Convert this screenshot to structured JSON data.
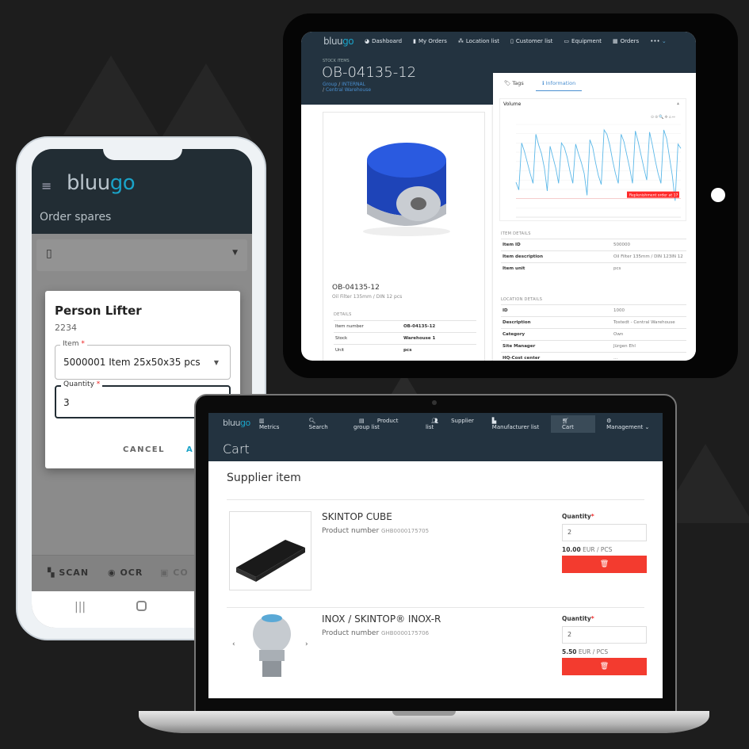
{
  "tablet": {
    "logo": {
      "a": "bluu",
      "b": "go"
    },
    "nav": [
      "Dashboard",
      "My Orders",
      "Location list",
      "Customer list",
      "Equipment",
      "Orders",
      "•••"
    ],
    "nav_icons": [
      "dashboard-icon",
      "clipboard-icon",
      "sitemap-icon",
      "building-icon",
      "keyboard-icon",
      "table-icon",
      "more-icon"
    ],
    "section_label": "STOCK ITEMS",
    "title": "OB-04135-12",
    "breadcrumb": [
      "Group",
      "INTERNAL",
      "Central Warehouse"
    ],
    "tabs": [
      "Tags",
      "Information"
    ],
    "active_tab": "Information",
    "product": {
      "name": "OB-04135-12",
      "description": "Oil Filter 135mm / DIN 12   pcs",
      "details_label": "DETAILS",
      "details": [
        {
          "k": "Item number",
          "v": "OB-04135-12"
        },
        {
          "k": "Stock",
          "v": "Warehouse 1"
        },
        {
          "k": "Unit",
          "v": "pcs"
        }
      ]
    },
    "item_details_label": "ITEM DETAILS",
    "item_details": [
      {
        "k": "Item ID",
        "v": "500000"
      },
      {
        "k": "Item description",
        "v": "Oil Filter 135mm / DIN 123IN 12"
      },
      {
        "k": "Item unit",
        "v": "pcs"
      }
    ],
    "location_details_label": "LOCATION DETAILS",
    "location_details": [
      {
        "k": "ID",
        "v": "1000"
      },
      {
        "k": "Description",
        "v": "Tostedt - Central Warehouse"
      },
      {
        "k": "Category",
        "v": "Own"
      },
      {
        "k": "Site Manager",
        "v": "Jürgen Ehl"
      },
      {
        "k": "HQ-Cost center",
        "v": "…"
      }
    ]
  },
  "chart_data": {
    "type": "line",
    "title": "Volume",
    "ylim": [
      0,
      85
    ],
    "grid": true,
    "series": [
      {
        "values": [
          32,
          25,
          68,
          60,
          50,
          40,
          31,
          76,
          66,
          58,
          45,
          24,
          65,
          55,
          45,
          31,
          68,
          64,
          55,
          42,
          31,
          67,
          58,
          50,
          40,
          20,
          71,
          64,
          50,
          38,
          30,
          80,
          76,
          66,
          52,
          40,
          31,
          76,
          69,
          57,
          45,
          31,
          79,
          69,
          57,
          45,
          34,
          78,
          66,
          52,
          40,
          31,
          80,
          72,
          55,
          38,
          15,
          67,
          63
        ],
        "color": "#5cb8e8"
      }
    ],
    "threshold": {
      "value": 17,
      "label": "Replenishment order at 17",
      "color": "#ff2a2a"
    }
  },
  "phone": {
    "logo": {
      "a": "bluu",
      "b": "go"
    },
    "title": "Order spares",
    "dialog": {
      "title": "Person Lifter",
      "subtitle": "2234",
      "item_label": "Item",
      "item_value": "5000001 Item 25x50x35 pcs",
      "quantity_label": "Quantity",
      "quantity_value": "3",
      "cancel": "CANCEL",
      "ok": "A"
    },
    "bottom_actions": [
      "SCAN",
      "OCR",
      "CO"
    ],
    "required_mark": "*"
  },
  "laptop": {
    "logo": {
      "a": "bluu",
      "b": "go"
    },
    "nav": [
      "Metrics",
      "Search",
      "Product group list",
      "Supplier list",
      "Manufacturer list",
      "Cart",
      "Management ⌄"
    ],
    "active_nav": "Cart",
    "page_title": "Cart",
    "section_title": "Supplier item",
    "items": [
      {
        "name": "SKINTOP CUBE",
        "pn_label": "Product number",
        "pn": "GHB0000175705",
        "qty_label": "Quantity",
        "qty": "2",
        "price": "10.00",
        "unit": "EUR / PCS"
      },
      {
        "name": "INOX / SKINTOP® INOX-R",
        "pn_label": "Product number",
        "pn": "GHB0000175706",
        "qty_label": "Quantity",
        "qty": "2",
        "price": "5.50",
        "unit": "EUR / PCS"
      }
    ],
    "colors": {
      "accent": "#f33b2f",
      "header": "#233340"
    }
  }
}
